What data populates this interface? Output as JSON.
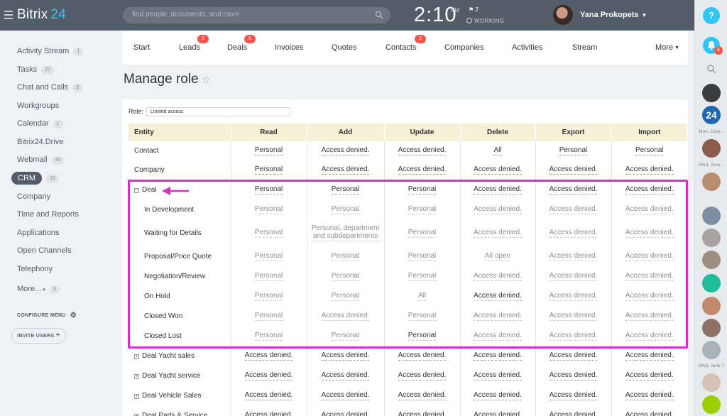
{
  "header": {
    "brand_name": "Bitrix",
    "brand_num": "24",
    "search_placeholder": "find people, documents, and more",
    "clock": "2:10",
    "clock_suffix": "PM",
    "flag_count": "2",
    "work_status": "WORKING",
    "user_name": "Yana Prokopets"
  },
  "sidebar": {
    "items": [
      {
        "label": "Activity Stream",
        "badge": "1"
      },
      {
        "label": "Tasks",
        "badge": "27"
      },
      {
        "label": "Chat and Calls",
        "badge": "3"
      },
      {
        "label": "Workgroups",
        "badge": ""
      },
      {
        "label": "Calendar",
        "badge": "1"
      },
      {
        "label": "Bitrix24.Drive",
        "badge": ""
      },
      {
        "label": "Webmail",
        "badge": "44"
      },
      {
        "label": "CRM",
        "badge": "12"
      },
      {
        "label": "Company",
        "badge": ""
      },
      {
        "label": "Time and Reports",
        "badge": ""
      },
      {
        "label": "Applications",
        "badge": ""
      },
      {
        "label": "Open Channels",
        "badge": ""
      },
      {
        "label": "Telephony",
        "badge": ""
      },
      {
        "label": "More...",
        "badge": "3"
      }
    ],
    "configure_label": "CONFIGURE MENU",
    "invite_label": "INVITE USERS"
  },
  "tabs": [
    {
      "label": "Start",
      "badge": ""
    },
    {
      "label": "Leads",
      "badge": "3"
    },
    {
      "label": "Deals",
      "badge": "6"
    },
    {
      "label": "Invoices",
      "badge": ""
    },
    {
      "label": "Quotes",
      "badge": ""
    },
    {
      "label": "Contacts",
      "badge": "3"
    },
    {
      "label": "Companies",
      "badge": ""
    },
    {
      "label": "Activities",
      "badge": ""
    },
    {
      "label": "Stream",
      "badge": ""
    },
    {
      "label": "More",
      "badge": ""
    }
  ],
  "page": {
    "title": "Manage role",
    "role_label": "Role:",
    "role_value": "Limited access"
  },
  "table": {
    "headers": [
      "Entity",
      "Read",
      "Add",
      "Update",
      "Delete",
      "Export",
      "Import"
    ],
    "rows": [
      {
        "entity": "Contact",
        "kind": "top",
        "cells": [
          "Personal",
          "Access denied.",
          "Access denied.",
          "All",
          "Personal",
          "Personal"
        ]
      },
      {
        "entity": "Company",
        "kind": "top",
        "cells": [
          "Personal",
          "Access denied.",
          "Access denied.",
          "Access denied.",
          "Access denied.",
          "Access denied."
        ]
      },
      {
        "entity": "Deal",
        "kind": "expanded",
        "cells": [
          "Personal",
          "Personal",
          "Personal",
          "Access denied.",
          "Access denied.",
          "Access denied."
        ]
      },
      {
        "entity": "In Development",
        "kind": "child",
        "cells": [
          "Personal",
          "Personal",
          "Personal",
          "Access denied.",
          "Access denied.",
          "Access denied."
        ]
      },
      {
        "entity": "Waiting for Details",
        "kind": "child",
        "cells": [
          "Personal",
          "Personal, department and subdepartments",
          "Personal",
          "Access denied.",
          "Access denied.",
          "Access denied."
        ]
      },
      {
        "entity": "Proposal/Price Quote",
        "kind": "child",
        "cells": [
          "Personal",
          "Personal",
          "Personal",
          "All open",
          "Access denied.",
          "Access denied."
        ]
      },
      {
        "entity": "Negotiation/Review",
        "kind": "child",
        "cells": [
          "Personal",
          "Personal",
          "Personal",
          "Access denied.",
          "Access denied.",
          "Access denied."
        ]
      },
      {
        "entity": "On Hold",
        "kind": "child",
        "cells": [
          "Personal",
          "Personal",
          "All",
          "Access denied.",
          "Access denied.",
          "Access denied."
        ]
      },
      {
        "entity": "Closed Won",
        "kind": "child",
        "cells": [
          "Personal",
          "Access denied.",
          "Personal",
          "Access denied.",
          "Access denied.",
          "Access denied."
        ]
      },
      {
        "entity": "Closed Lost",
        "kind": "child",
        "cells": [
          "Personal",
          "Personal",
          "Personal",
          "Access denied.",
          "Access denied.",
          "Access denied."
        ]
      },
      {
        "entity": "Deal Yacht sales",
        "kind": "collapsed",
        "cells": [
          "Access denied.",
          "Access denied.",
          "Access denied.",
          "Access denied.",
          "Access denied.",
          "Access denied."
        ]
      },
      {
        "entity": "Deal Yacht service",
        "kind": "collapsed",
        "cells": [
          "Access denied.",
          "Access denied.",
          "Access denied.",
          "Access denied.",
          "Access denied.",
          "Access denied."
        ]
      },
      {
        "entity": "Deal Vehicle Sales",
        "kind": "collapsed",
        "cells": [
          "Access denied.",
          "Access denied.",
          "Access denied.",
          "Access denied.",
          "Access denied.",
          "Access denied."
        ]
      },
      {
        "entity": "Deal Parts & Service",
        "kind": "collapsed",
        "cells": [
          "Access denied.",
          "Access denied.",
          "Access denied.",
          "Access denied.",
          "Access denied.",
          "Access denied."
        ]
      }
    ],
    "highlighted_cells": [
      [
        0,
        1,
        0,
        0,
        0,
        0
      ],
      [
        0,
        0,
        0,
        0,
        0,
        0
      ],
      [
        0,
        0,
        0,
        0,
        0,
        0
      ],
      [
        0,
        0,
        0,
        0,
        0,
        0
      ],
      [
        0,
        0,
        0,
        0,
        0,
        0
      ],
      [
        0,
        0,
        0,
        1,
        0,
        0
      ],
      [
        0,
        0,
        0,
        0,
        0,
        0
      ],
      [
        0,
        0,
        1,
        0,
        0,
        0
      ],
      [
        0,
        1,
        0,
        0,
        0,
        0
      ],
      [
        0,
        0,
        0,
        0,
        0,
        0
      ]
    ]
  },
  "rail": {
    "help_label": "?",
    "notif_count": "1",
    "b24_label": "24",
    "dates": [
      "Mon, June...",
      "Wed, June...",
      "Wed, June 7"
    ]
  },
  "colors": {
    "header_bg": "#535c69",
    "accent": "#2fc6f6",
    "badge_red": "#f4544b",
    "highlight": "#d62fc7",
    "table_header": "#f5f0d6"
  }
}
